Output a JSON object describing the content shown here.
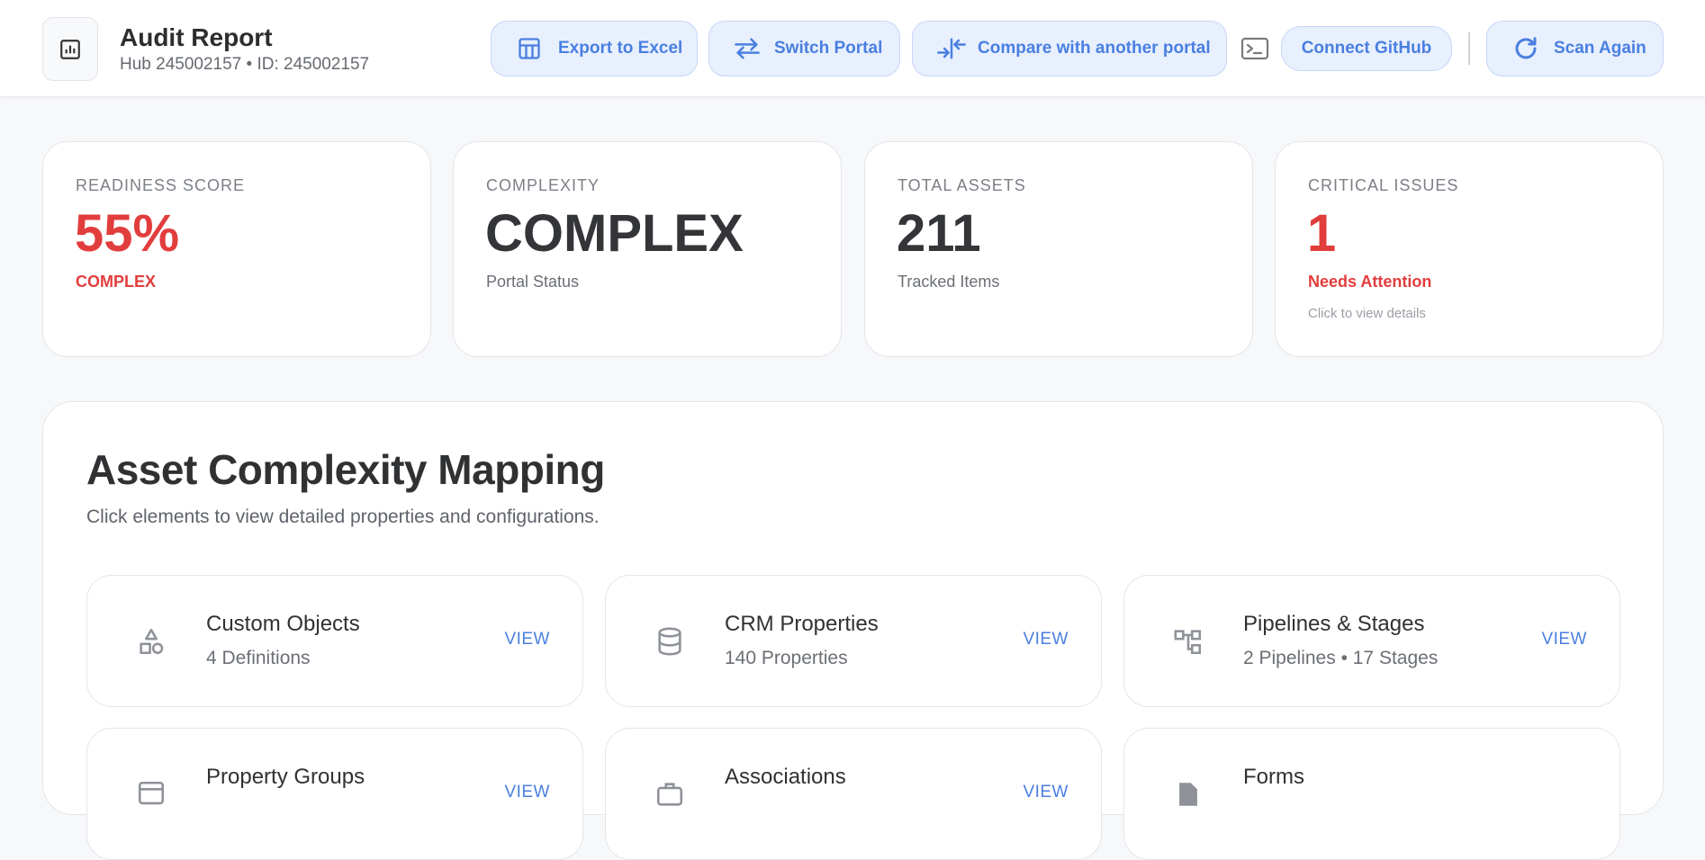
{
  "header": {
    "title": "Audit Report",
    "subtitle": "Hub 245002157 • ID: 245002157",
    "buttons": {
      "export": "Export to Excel",
      "switch": "Switch Portal",
      "compare": "Compare with another portal",
      "github": "Connect GitHub",
      "scan": "Scan Again"
    },
    "icons": {
      "app": "chart-icon",
      "export": "table-icon",
      "switch": "swap-arrows-icon",
      "compare": "compare-arrows-icon",
      "terminal": "terminal-icon",
      "scan": "refresh-icon"
    }
  },
  "stats": [
    {
      "label": "READINESS SCORE",
      "value": "55%",
      "sub": "COMPLEX"
    },
    {
      "label": "COMPLEXITY",
      "value": "COMPLEX",
      "sub": "Portal Status"
    },
    {
      "label": "TOTAL ASSETS",
      "value": "211",
      "sub": "Tracked Items"
    },
    {
      "label": "CRITICAL ISSUES",
      "value": "1",
      "sub": "Needs Attention",
      "hint": "Click to view details"
    }
  ],
  "mapping": {
    "title": "Asset Complexity Mapping",
    "description": "Click elements to view detailed properties and configurations.",
    "view_label": "VIEW",
    "tiles": [
      {
        "name": "Custom Objects",
        "count": "4 Definitions",
        "icon": "shapes-icon"
      },
      {
        "name": "CRM Properties",
        "count": "140 Properties",
        "icon": "database-icon"
      },
      {
        "name": "Pipelines & Stages",
        "count": "2 Pipelines • 17 Stages",
        "icon": "workflow-icon"
      },
      {
        "name": "Property Groups",
        "count": "",
        "icon": "folder-icon"
      },
      {
        "name": "Associations",
        "count": "",
        "icon": "briefcase-icon"
      },
      {
        "name": "Forms",
        "count": "",
        "icon": "file-icon"
      }
    ]
  },
  "colors": {
    "accent": "#4a7fe0",
    "button_bg": "#e8f0fe",
    "danger": "#e23d3d",
    "page_bg": "#f7f8fa"
  }
}
